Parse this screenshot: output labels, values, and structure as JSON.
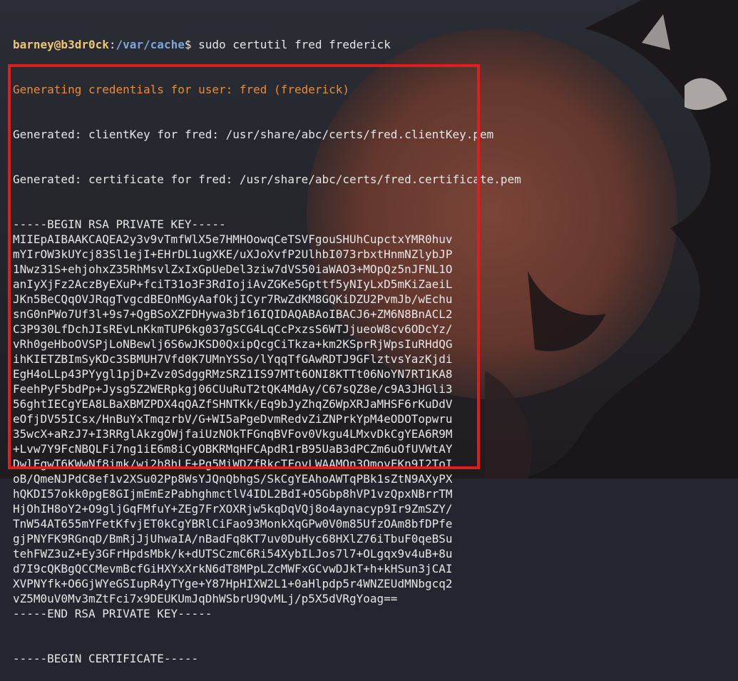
{
  "prompt": {
    "user_host": "barney@b3dr0ck",
    "separator": ":",
    "cwd": "/var/cache",
    "symbol": "$",
    "command": " sudo certutil fred frederick"
  },
  "output": {
    "generating": "Generating credentials for user: fred (frederick)",
    "generated_key": "Generated: clientKey for fred: /usr/share/abc/certs/fred.clientKey.pem",
    "generated_cert": "Generated: certificate for fred: /usr/share/abc/certs/fred.certificate.pem"
  },
  "key_lines": [
    "-----BEGIN RSA PRIVATE KEY-----",
    "MIIEpAIBAAKCAQEA2y3v9vTmfWlX5e7HMHOowqCeTSVFgouSHUhCupctxYMR0huv",
    "mYIrOW3kUYcj83Sl1ejI+EHrDL1ugXKE/uXJoXvfP2UlhbI073rbxtHnmNZlybJP",
    "1Nwz31S+ehjohxZ35RhMsvlZxIxGpUeDel3ziw7dVS50iaWAO3+MOpQz5nJFNL1O",
    "anIyXjFz2AczByEXuP+fciT31o3F3RdIojiAvZGKe5Gpttf5yNIyLxD5mKiZaeiL",
    "JKn5BeCQqOVJRqgTvgcdBEOnMGyAafOkjICyr7RwZdKM8GQKiDZU2PvmJb/wEchu",
    "snG0nPWo7Uf3l+9s7+QgBSoXZFDHywa3bf16IQIDAQABAoIBACJ6+ZM6N8BnACL2",
    "C3P930LfDchJIsREvLnKkmTUP6kg037gSCG4LqCcPxzsS6WTJjueoW8cv6ODcYz/",
    "vRh0geHboOVSPjLoNBewlj6S6wJKSD0QxipQcgCiTkza+km2KSprRjWpsIuRHdQG",
    "ihKIETZBImSyKDc3SBMUH7Vfd0K7UMnYSSo/lYqqTfGAwRDTJ9GFlztvsYazKjdi",
    "EgH4oLLp43PYygl1pjD+Zvz0SdggRMzSRZ1IS97MTt6ONI8KTTt06NoYN7RT1KA8",
    "FeehPyF5bdPp+Jysg5Z2WERpkgj06CUuRuT2tQK4MdAy/C67sQZ8e/c9A3JHGli3",
    "56ghtIECgYEA8LBaXBMZPDX4qQAZfSHNTKk/Eq9bJyZhqZ6WpXRJaMHSF6rKuDdV",
    "eOfjDV55ICsx/HnBuYxTmqzrbV/G+WI5aPgeDvmRedvZiZNPrkYpM4eODOTopwru",
    "35wcX+aRzJ7+I3RRglAkzgOWjfaiUzNOkTFGnqBVFov0Vkgu4LMxvDkCgYEA6R9M",
    "+Lvw7Y9FcNBQLFi7ng1iE6m8iCyOBKRMqHFCApdR1rB95UaB3dPCZm6uOfUVWtAY",
    "DwlEgwT6KWwNf8imk/wi2h8hLF+Pg5MiWDZfRkcTFovLWAAMOn3OmovFKn9I2ToI",
    "oB/QmeNJPdC8ef1v2XSu02Pp8WsYJQnQbhgS/SkCgYEAhoAWTqPBk1sZtN9AXyPX",
    "hQKDI57okk0pgE8GIjmEmEzPabhghmctlV4IDL2BdI+O5Gbp8hVP1vzQpxNBrrTM",
    "HjOhIH8oY2+O9gljGqFMfuY+ZEg7FrXOXRjw5kqDqVQj8o4aynacyp9Ir9ZmSZY/",
    "TnW54AT655mYFetKfvjET0kCgYBRlCiFao93MonkXqGPw0V0m85UfzOAm8bfDPfe",
    "gjPNYFK9RGnqD/BmRjJjUhwaIA/nBadFq8KT7uv0DuHyc68HXlZ76iTbuF0qeBSu",
    "tehFWZ3uZ+Ey3GFrHpdsMbk/k+dUTSCzmC6Ri54XybILJos7l7+OLgqx9v4uB+8u",
    "d7I9cQKBgQCCMevmBcfGiHXYxXrkN6dT8MPpLZcMWFxGCvwDJkT+h+kHSun3jCAI",
    "XVPNYfk+O6GjWYeGSIupR4yTYge+Y87HpHIXW2L1+0aHlpdp5r4WNZEUdMNbgcq2",
    "vZ5M0uV0Mv3mZtFci7x9DEUKUmJqDhWSbrU9QvMLj/p5X5dVRgYoag==",
    "-----END RSA PRIVATE KEY-----"
  ],
  "next_line": "-----BEGIN CERTIFICATE-----",
  "colors": {
    "background": "#23262e",
    "prompt_user": "#f0c674",
    "prompt_path": "#7aa6da",
    "highlight_box": "#e01c1c",
    "generating_text": "#e98b39"
  }
}
